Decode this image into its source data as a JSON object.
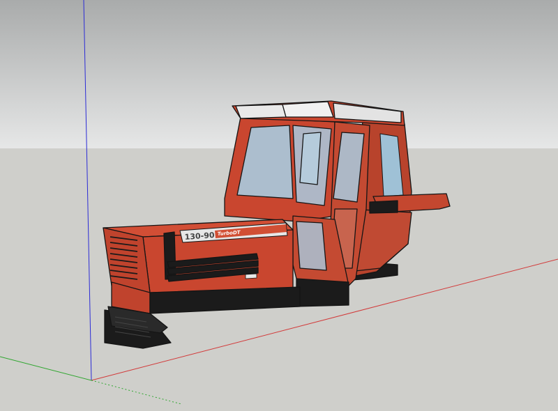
{
  "scene": {
    "sky_color": "#c9cbcb",
    "ground_color": "#cfcfcb",
    "axis_colors": {
      "blue": "#2b2bd6",
      "red": "#d23a3a",
      "green": "#2fa62f"
    }
  },
  "model": {
    "body_color": "#c9462f",
    "dark_color": "#1b1b1b",
    "glass_color": "#a9cbe0",
    "badge": {
      "model_number": "130-90",
      "brand_text": "TurboDT"
    }
  }
}
